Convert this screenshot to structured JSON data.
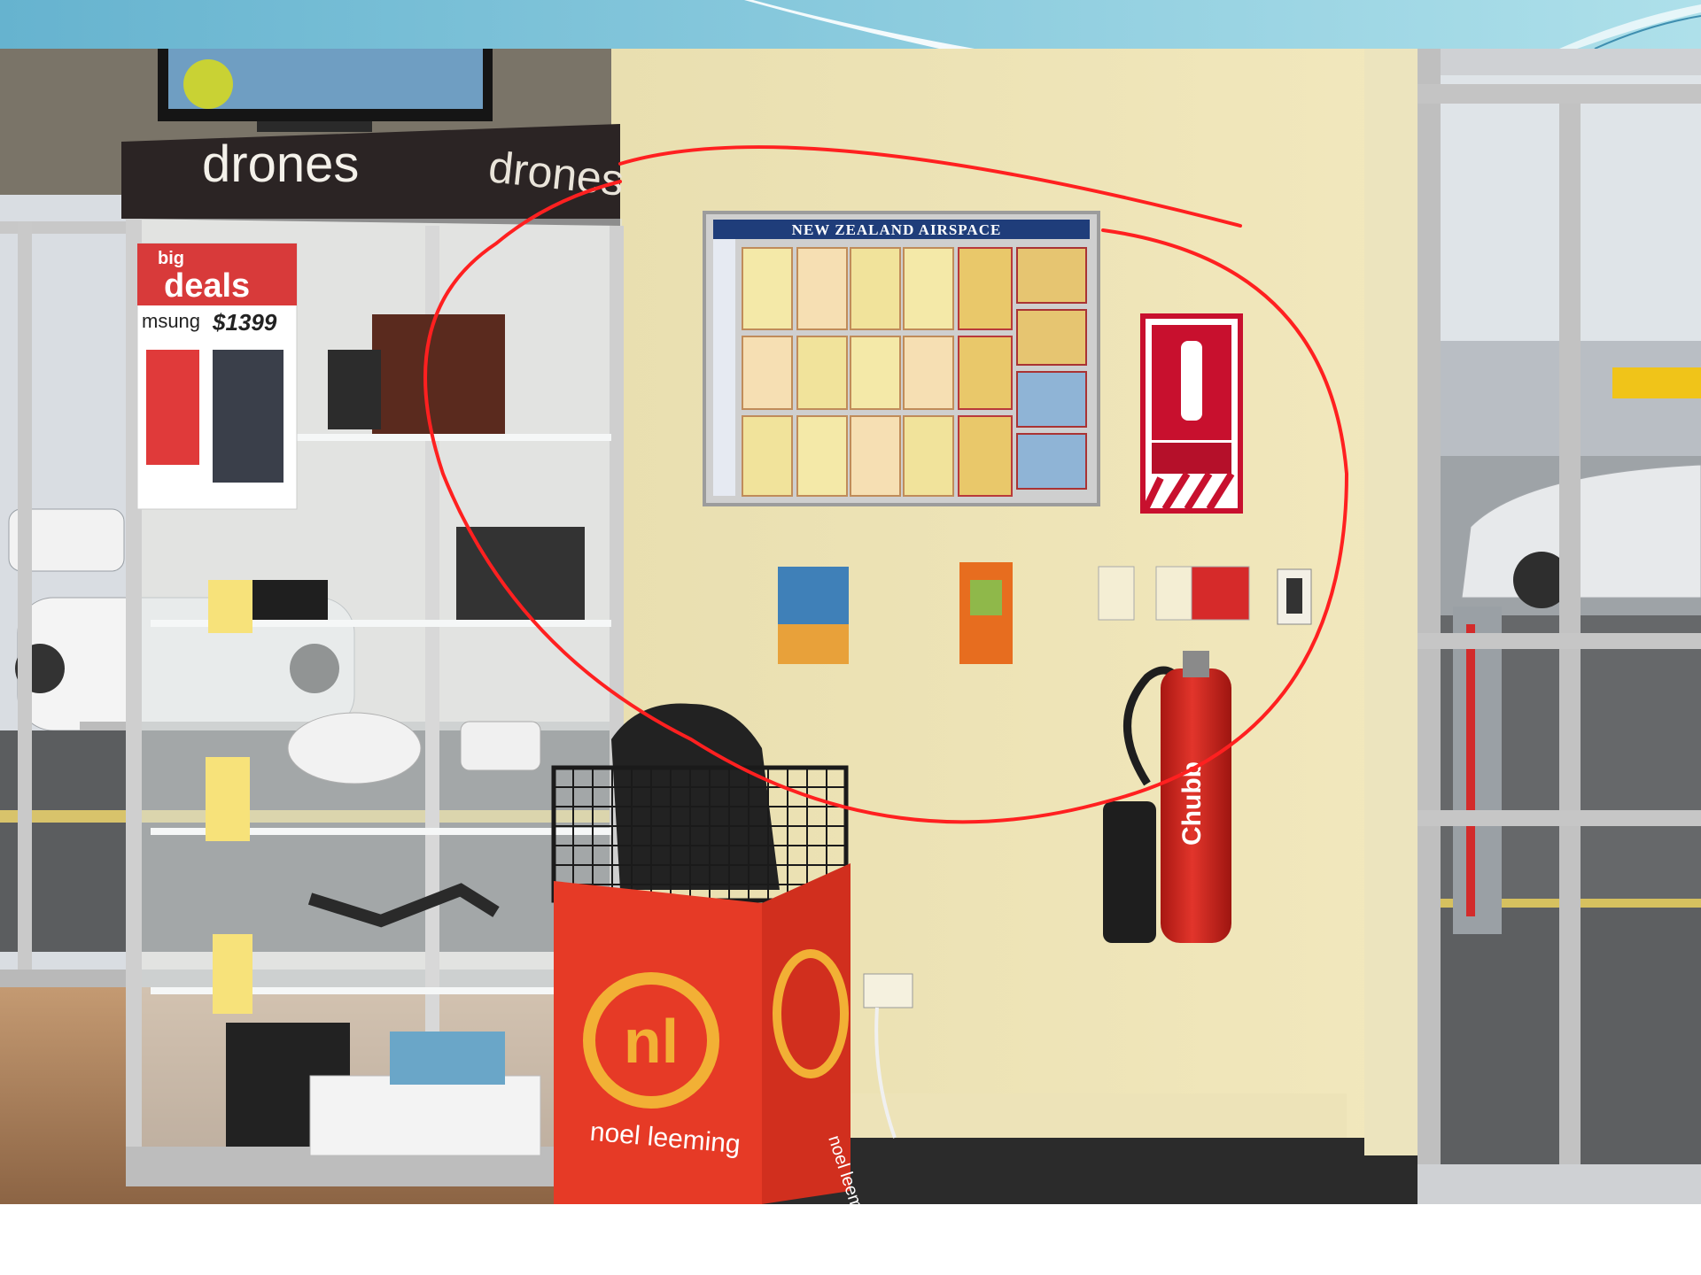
{
  "slide": {
    "banner": {
      "colors": [
        "#6fb7d2",
        "#a9dbe6",
        "#ffffff"
      ]
    }
  },
  "photo": {
    "cabinet": {
      "header_left": "drones",
      "header_right": "drones"
    },
    "promo": {
      "top_line": "big",
      "headline": "deals",
      "brand_fragment": "msung",
      "price": "$1399"
    },
    "airspace_poster": {
      "title": "NEW ZEALAND AIRSPACE"
    },
    "bin": {
      "logo_letters": "nl",
      "brand": "noel leeming",
      "color": "#e63a26",
      "logo_color": "#f2b035"
    },
    "extinguisher": {
      "brand": "Chubb",
      "color": "#d7261f"
    },
    "fire_sign": {
      "color": "#c8102e"
    },
    "annotation": {
      "color": "#ff2020"
    }
  }
}
